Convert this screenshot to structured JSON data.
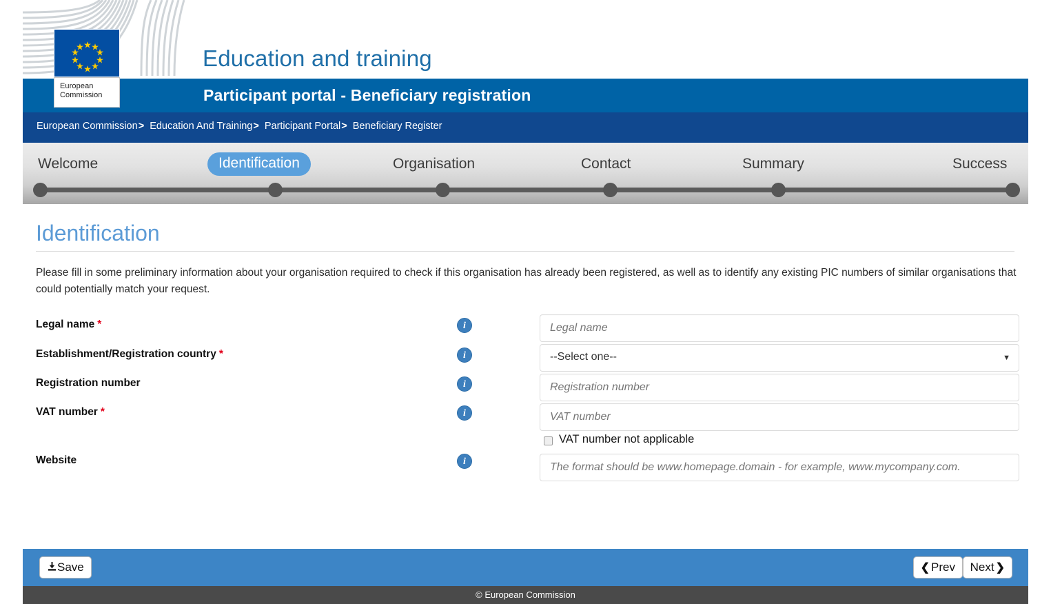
{
  "header": {
    "logo_caption_line1": "European",
    "logo_caption_line2": "Commission",
    "site_title": "Education and training",
    "titlebar_text": "Participant portal - Beneficiary registration"
  },
  "breadcrumb": {
    "separator": ">",
    "items": [
      "European Commission",
      "Education And Training",
      "Participant Portal",
      "Beneficiary Register"
    ]
  },
  "stepper": {
    "active_index": 1,
    "steps": [
      "Welcome",
      "Identification",
      "Organisation",
      "Contact",
      "Summary",
      "Success"
    ]
  },
  "main": {
    "page_title": "Identification",
    "intro": "Please fill in some preliminary information about your organisation required to check if this organisation has already been registered, as well as to identify any existing PIC numbers of similar organisations that could potentially match your request.",
    "required_marker": "*",
    "info_glyph": "i",
    "fields": [
      {
        "label": "Legal name",
        "required": true,
        "type": "text",
        "placeholder": "Legal name",
        "value": ""
      },
      {
        "label": "Establishment/Registration country",
        "required": true,
        "type": "select",
        "selected": "--Select one--",
        "caret": "▼"
      },
      {
        "label": "Registration number",
        "required": false,
        "type": "text",
        "placeholder": "Registration number",
        "value": ""
      },
      {
        "label": "VAT number",
        "required": true,
        "type": "text",
        "placeholder": "VAT number",
        "value": ""
      },
      {
        "label": "Website",
        "required": false,
        "type": "text",
        "placeholder": "The format should be www.homepage.domain - for example, www.mycompany.com.",
        "value": ""
      }
    ],
    "vat_not_applicable": {
      "label": "VAT number not applicable",
      "checked": false
    }
  },
  "actions": {
    "save_label": "Save",
    "prev_label": "Prev",
    "next_label": "Next",
    "prev_chevron": "❮",
    "next_chevron": "❯"
  },
  "footer": {
    "copyright": "© European Commission"
  },
  "colors": {
    "title_bar_blue": "#0063a6",
    "breadcrumb_blue": "#10488f",
    "accent_blue": "#5c9bd6",
    "active_step_blue": "#5aa0dc",
    "action_bar_blue": "#3d85c6",
    "footer_gray": "#4a4a4a",
    "required_red": "#e2001a",
    "eu_flag_blue": "#034ea2",
    "eu_star_yellow": "#ffcc00"
  }
}
